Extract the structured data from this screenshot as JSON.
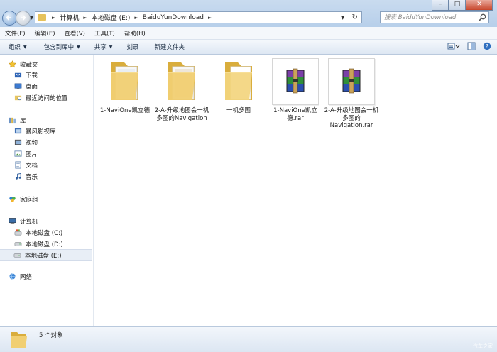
{
  "window": {
    "minimize_glyph": "–",
    "maximize_glyph": "□",
    "close_glyph": "✕"
  },
  "address": {
    "breadcrumbs": [
      "计算机",
      "本地磁盘 (E:)",
      "BaiduYunDownload"
    ],
    "separator": "►",
    "dropdown_glyph": "▼",
    "refresh_glyph": "↻"
  },
  "search": {
    "placeholder": "搜索 BaiduYunDownload",
    "icon": "search-icon"
  },
  "menu": {
    "items": [
      "文件(F)",
      "编辑(E)",
      "查看(V)",
      "工具(T)",
      "帮助(H)"
    ]
  },
  "toolbar": {
    "organize": "组织",
    "include_in_library": "包含到库中",
    "share": "共享",
    "burn": "刻录",
    "new_folder": "新建文件夹",
    "dropdown_glyph": "▼"
  },
  "navigation": {
    "favorites_header": "收藏夹",
    "favorites": [
      "下载",
      "桌面",
      "最近访问的位置"
    ],
    "libraries_header": "库",
    "libraries": [
      "暴风影视库",
      "视频",
      "图片",
      "文档",
      "音乐"
    ],
    "homegroup": "家庭组",
    "computer_header": "计算机",
    "drives": [
      "本地磁盘 (C:)",
      "本地磁盘 (D:)",
      "本地磁盘 (E:)"
    ],
    "selected_drive_index": 2,
    "network": "网络"
  },
  "files": [
    {
      "name": "1-NaviOne凯立德",
      "type": "folder"
    },
    {
      "name": "2-A-升级地图会一机多图的Navigation",
      "type": "folder"
    },
    {
      "name": "一机多图",
      "type": "folder"
    },
    {
      "name": "1-NaviOne凯立德.rar",
      "type": "rar"
    },
    {
      "name": "2-A-升级地图会一机多图的Navigation.rar",
      "type": "rar"
    }
  ],
  "status": {
    "count_text": "5 个对象"
  },
  "watermark": "汽车之家",
  "colors": {
    "folder": "#e8c660",
    "selected_row": "#e8eef6",
    "titlebar": "#c2d6ee"
  }
}
